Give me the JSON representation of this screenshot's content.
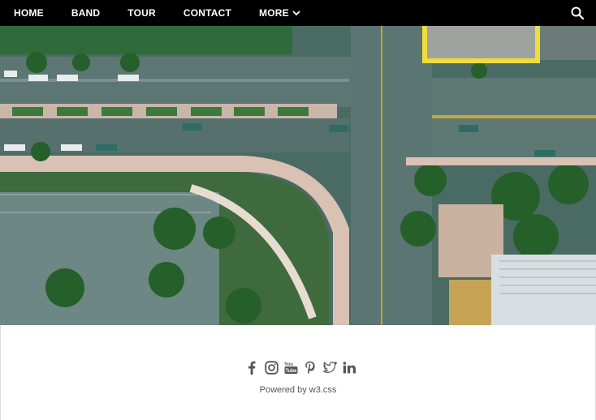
{
  "nav": {
    "items": [
      {
        "label": "HOME"
      },
      {
        "label": "BAND"
      },
      {
        "label": "TOUR"
      },
      {
        "label": "CONTACT"
      },
      {
        "label": "MORE"
      }
    ],
    "search_icon": "search-icon",
    "more_icon": "chevron-down-icon"
  },
  "hero": {
    "image": "aerial-intersection-photo"
  },
  "footer": {
    "social_icons": [
      "facebook-icon",
      "instagram-icon",
      "youtube-icon",
      "pinterest-icon",
      "twitter-icon",
      "linkedin-icon"
    ],
    "powered_by": "Powered by w3.css"
  },
  "colors": {
    "nav_bg": "#000000",
    "nav_text": "#ffffff",
    "footer_icon": "#555555"
  }
}
